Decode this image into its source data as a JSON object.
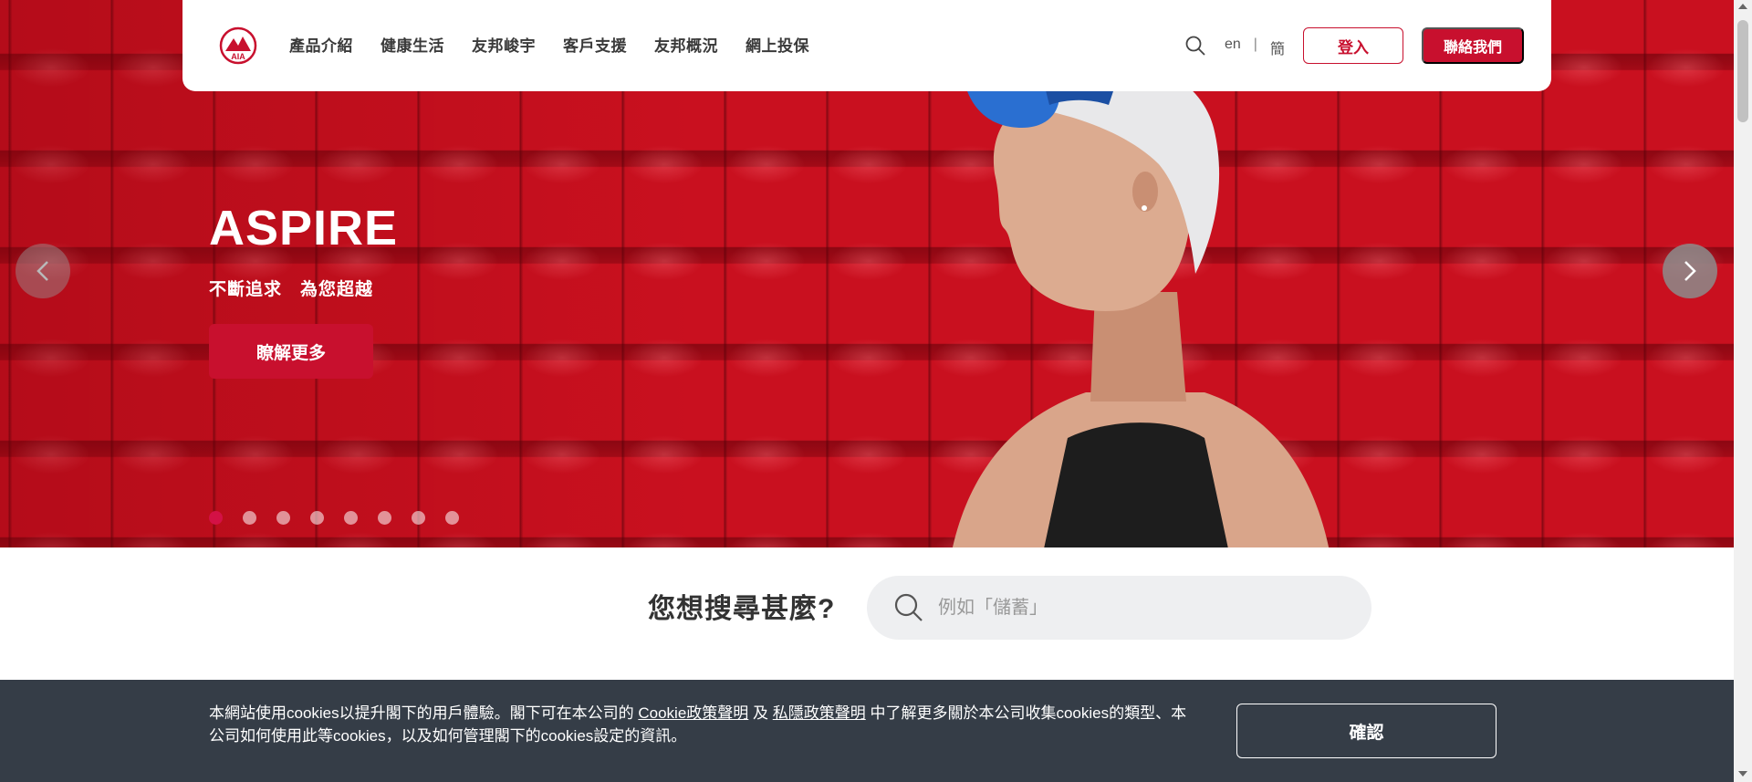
{
  "colors": {
    "brand": "#c8102e",
    "hero_background": "#c9101f",
    "cookie_bar": "#353d47",
    "search_box": "#eeeff1",
    "active_dot": "#d31145"
  },
  "header": {
    "logo": "aia-logo",
    "nav": [
      "產品介紹",
      "健康生活",
      "友邦峻宇",
      "客戶支援",
      "友邦概況",
      "網上投保"
    ],
    "search_icon": "search-icon",
    "lang_en": "en",
    "lang_sep": "|",
    "lang_sc": "簡",
    "login_label": "登入",
    "contact_label": "聯絡我們"
  },
  "hero": {
    "title": "ASPIRE",
    "subtitle": "不斷追求　為您超越",
    "cta_label": "瞭解更多",
    "prev_icon": "chevron-left-icon",
    "next_icon": "chevron-right-icon",
    "slide_count": 8,
    "active_slide": 1
  },
  "search": {
    "label": "您想搜尋甚麼?",
    "placeholder": "例如「儲蓄」",
    "icon": "search-icon"
  },
  "cookie": {
    "text_before": "本網站使用cookies以提升閣下的用戶體驗。閣下可在本公司的 ",
    "link1": "Cookie政策聲明",
    "text_mid": " 及 ",
    "link2": "私隱政策聲明",
    "text_after": " 中了解更多關於本公司收集cookies的類型、本公司如何使用此等cookies，以及如何管理閣下的cookies設定的資訊。",
    "confirm_label": "確認"
  }
}
